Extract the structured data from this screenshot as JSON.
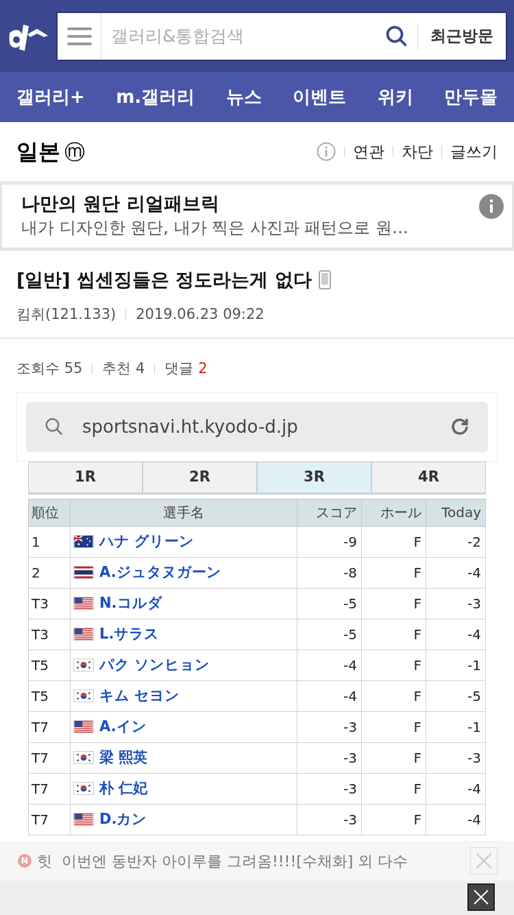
{
  "header": {
    "search_placeholder": "갤러리&통합검색",
    "recent": "최근방문"
  },
  "nav": [
    "갤러리+",
    "m.갤러리",
    "뉴스",
    "이벤트",
    "위키",
    "만두몰"
  ],
  "board": {
    "title": "일본",
    "badge": "ⓜ",
    "actions": [
      "연관",
      "차단",
      "글쓰기"
    ]
  },
  "ad": {
    "title": "나만의 원단 리얼패브릭",
    "text": "내가 디자인한 원단, 내가 찍은 사진과 패턴으로 원…"
  },
  "post": {
    "title": "[일반] 씹센징들은 정도라는게 없다",
    "author": "킴취(121.133)",
    "date": "2019.06.23 09:22",
    "stats": [
      {
        "label": "조회수",
        "value": "55",
        "kind": "plain"
      },
      {
        "label": "추천",
        "value": "4",
        "kind": "plain"
      },
      {
        "label": "댓글",
        "value": "2",
        "kind": "comment"
      }
    ]
  },
  "embedded": {
    "url": "sportsnavi.ht.kyodo-d.jp",
    "rounds": [
      {
        "label": "1R",
        "selected": false
      },
      {
        "label": "2R",
        "selected": false
      },
      {
        "label": "3R",
        "selected": true
      },
      {
        "label": "4R",
        "selected": false
      }
    ],
    "columns": [
      "順位",
      "選手名",
      "スコア",
      "ホール",
      "Today"
    ],
    "rows": [
      {
        "rank": "1",
        "kind": "au",
        "name": "ハナ グリーン",
        "score": "-9",
        "hole": "F",
        "today": "-2"
      },
      {
        "rank": "2",
        "kind": "th",
        "name": "A.ジュタヌガーン",
        "score": "-8",
        "hole": "F",
        "today": "-4"
      },
      {
        "rank": "T3",
        "kind": "us",
        "name": "N.コルダ",
        "score": "-5",
        "hole": "F",
        "today": "-3"
      },
      {
        "rank": "T3",
        "kind": "us",
        "name": "L.サラス",
        "score": "-5",
        "hole": "F",
        "today": "-4"
      },
      {
        "rank": "T5",
        "kind": "kr",
        "name": "パク ソンヒョン",
        "score": "-4",
        "hole": "F",
        "today": "-1"
      },
      {
        "rank": "T5",
        "kind": "kr",
        "name": "キム セヨン",
        "score": "-4",
        "hole": "F",
        "today": "-5"
      },
      {
        "rank": "T7",
        "kind": "us",
        "name": "A.イン",
        "score": "-3",
        "hole": "F",
        "today": "-1"
      },
      {
        "rank": "T7",
        "kind": "kr",
        "name": "梁 熙英",
        "score": "-3",
        "hole": "F",
        "today": "-3"
      },
      {
        "rank": "T7",
        "kind": "kr",
        "name": "朴 仁妃",
        "score": "-3",
        "hole": "F",
        "today": "-4"
      },
      {
        "rank": "T7",
        "kind": "us",
        "name": "D.カン",
        "score": "-3",
        "hole": "F",
        "today": "-4"
      }
    ]
  },
  "notice": {
    "badge": "N",
    "text": "힛  이번엔 동반자 아이루를 그려옴!!!![수채화] 외 다수"
  }
}
